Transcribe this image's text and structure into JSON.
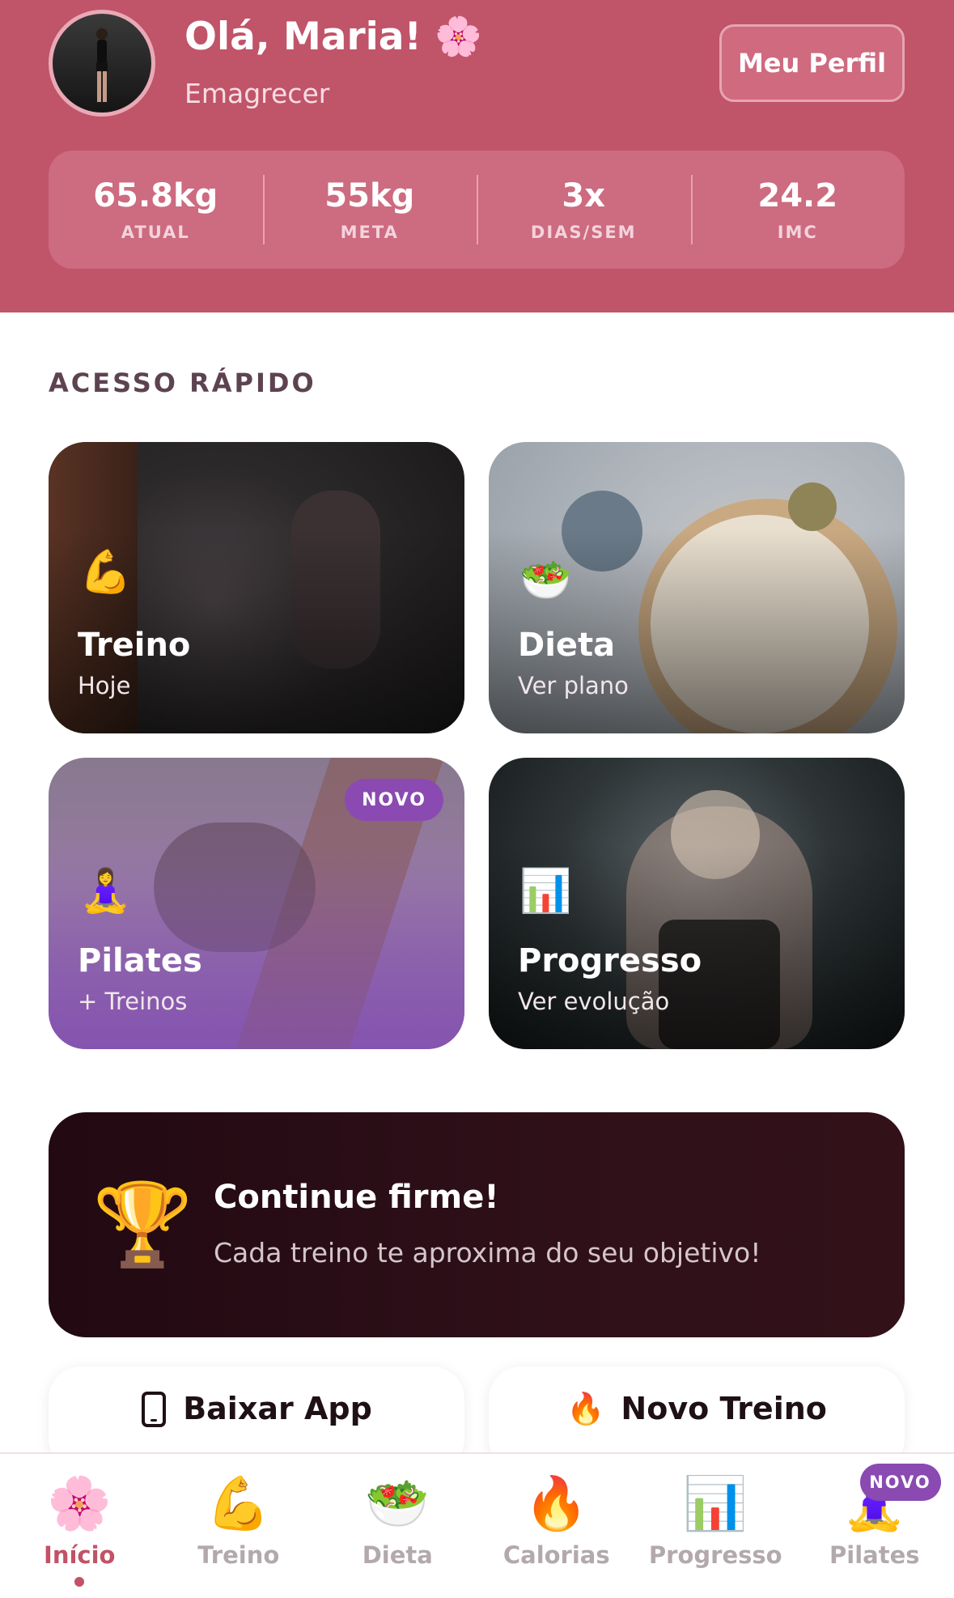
{
  "header": {
    "greeting": "Olá, Maria! 🌸",
    "goal": "Emagrecer",
    "profile_button": "Meu Perfil"
  },
  "stats": [
    {
      "value": "65.8kg",
      "label": "ATUAL"
    },
    {
      "value": "55kg",
      "label": "META"
    },
    {
      "value": "3x",
      "label": "DIAS/SEM"
    },
    {
      "value": "24.2",
      "label": "IMC"
    }
  ],
  "quick_access": {
    "title": "ACESSO RÁPIDO",
    "cards": [
      {
        "emoji": "💪",
        "title": "Treino",
        "subtitle": "Hoje"
      },
      {
        "emoji": "🥗",
        "title": "Dieta",
        "subtitle": "Ver plano"
      },
      {
        "emoji": "🧘‍♀️",
        "title": "Pilates",
        "subtitle": "+ Treinos",
        "badge": "NOVO"
      },
      {
        "emoji": "📊",
        "title": "Progresso",
        "subtitle": "Ver evolução"
      }
    ]
  },
  "motivation": {
    "icon": "🏆",
    "title": "Continue firme!",
    "subtitle": "Cada treino te aproxima do seu objetivo!"
  },
  "actions": [
    {
      "icon": "phone-icon",
      "label": "Baixar App"
    },
    {
      "icon": "🔥",
      "label": "Novo Treino"
    }
  ],
  "nav": [
    {
      "icon": "🌸",
      "label": "Início",
      "active": true
    },
    {
      "icon": "💪",
      "label": "Treino"
    },
    {
      "icon": "🥗",
      "label": "Dieta"
    },
    {
      "icon": "🔥",
      "label": "Calorias"
    },
    {
      "icon": "📊",
      "label": "Progresso"
    },
    {
      "icon": "🧘‍♀️",
      "label": "Pilates",
      "badge": "NOVO"
    }
  ],
  "colors": {
    "brand": "#c05469",
    "accent_active": "#c25266",
    "badge": "#8a4ab2",
    "dark_card": "#2a0d16"
  }
}
